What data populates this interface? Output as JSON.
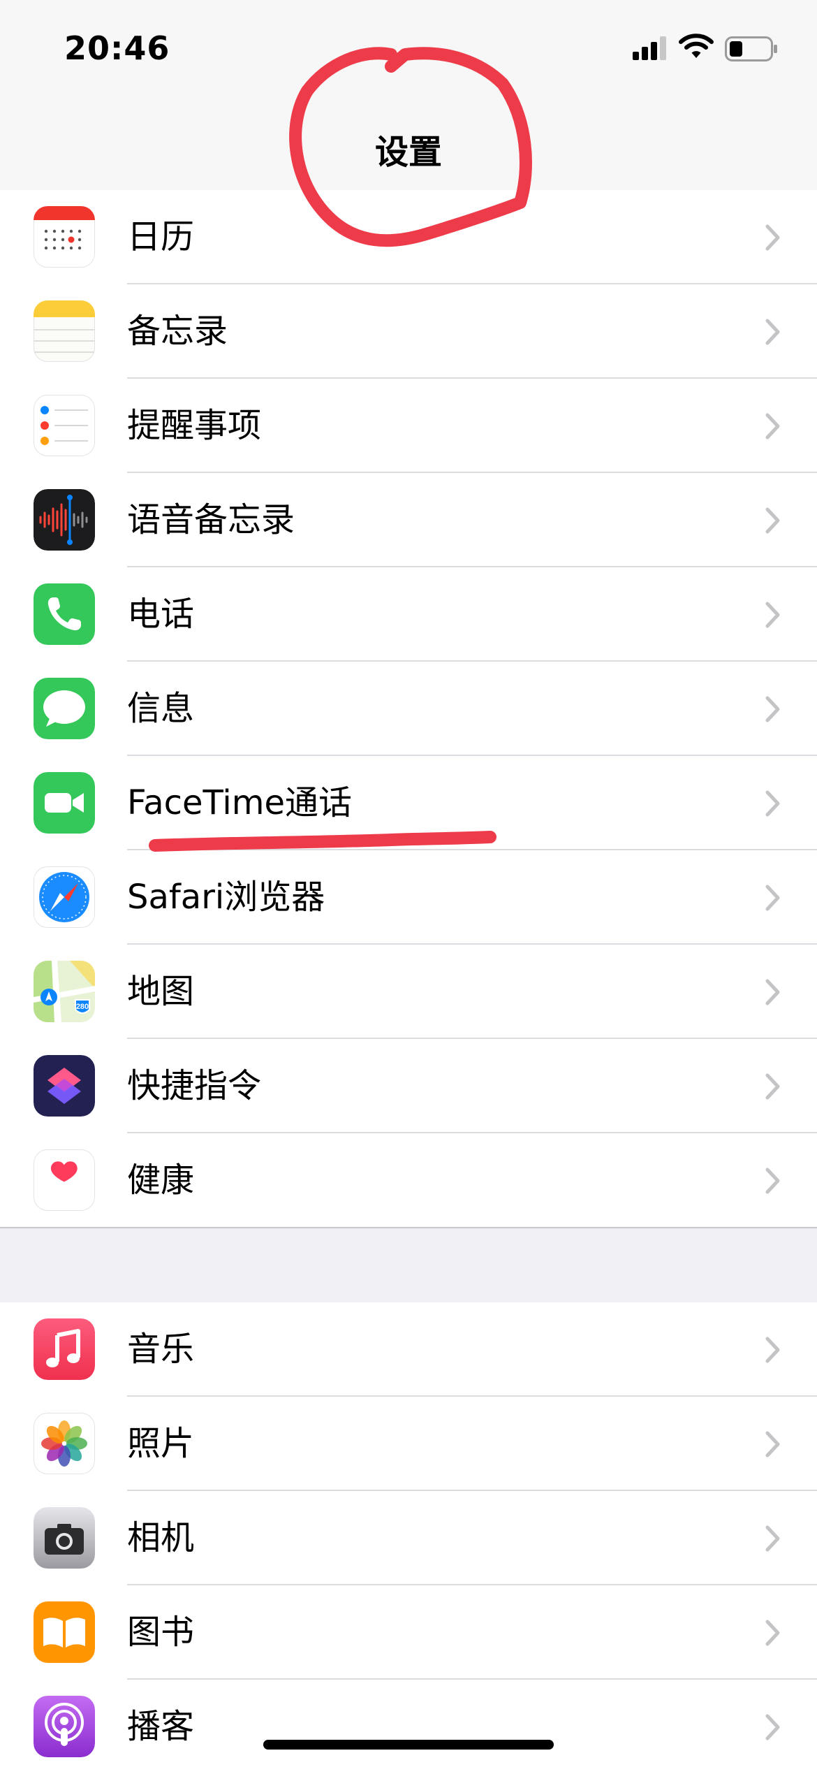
{
  "status": {
    "time": "20:46"
  },
  "nav": {
    "title": "设置"
  },
  "group1": [
    {
      "label": "日历",
      "icon": "calendar-icon"
    },
    {
      "label": "备忘录",
      "icon": "notes-icon"
    },
    {
      "label": "提醒事项",
      "icon": "reminders-icon"
    },
    {
      "label": "语音备忘录",
      "icon": "voice-memos-icon"
    },
    {
      "label": "电话",
      "icon": "phone-icon"
    },
    {
      "label": "信息",
      "icon": "messages-icon"
    },
    {
      "label": "FaceTime通话",
      "icon": "facetime-icon"
    },
    {
      "label": "Safari浏览器",
      "icon": "safari-icon"
    },
    {
      "label": "地图",
      "icon": "maps-icon"
    },
    {
      "label": "快捷指令",
      "icon": "shortcuts-icon"
    },
    {
      "label": "健康",
      "icon": "health-icon"
    }
  ],
  "group2": [
    {
      "label": "音乐",
      "icon": "music-icon"
    },
    {
      "label": "照片",
      "icon": "photos-icon"
    },
    {
      "label": "相机",
      "icon": "camera-icon"
    },
    {
      "label": "图书",
      "icon": "books-icon"
    },
    {
      "label": "播客",
      "icon": "podcasts-icon"
    }
  ],
  "maps_badge": "280",
  "colors": {
    "annotation": "#ee3b4a",
    "chevron": "#c4c4c7",
    "separator": "#dcdce0",
    "group_gap": "#efeff4"
  }
}
